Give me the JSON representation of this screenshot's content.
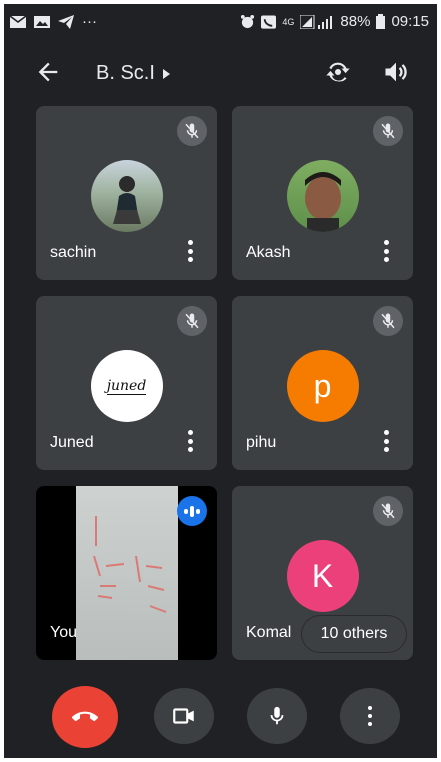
{
  "status_bar": {
    "battery": "88%",
    "time": "09:15",
    "network": "4G"
  },
  "app_bar": {
    "title": "B. Sc.I"
  },
  "participants": [
    {
      "name": "sachin",
      "muted": true,
      "avatar": "photo"
    },
    {
      "name": "Akash",
      "muted": true,
      "avatar": "photo"
    },
    {
      "name": "Juned",
      "muted": true,
      "avatar": "logo",
      "avatar_text": "juned"
    },
    {
      "name": "pihu",
      "muted": true,
      "avatar": "letter",
      "letter": "p",
      "color": "#f57c00"
    },
    {
      "name": "You",
      "muted": false,
      "speaking": true,
      "avatar": "camera"
    },
    {
      "name": "Komal",
      "muted": true,
      "avatar": "letter",
      "letter": "K",
      "color": "#ec407a"
    }
  ],
  "others_chip": "10 others",
  "colors": {
    "background": "#202124",
    "tile": "#3c4043",
    "end_call": "#ea4335",
    "speaking": "#1a73e8"
  },
  "controls": [
    {
      "icon": "end-call-icon"
    },
    {
      "icon": "video-camera-icon"
    },
    {
      "icon": "microphone-icon"
    },
    {
      "icon": "more-vert-icon"
    }
  ]
}
